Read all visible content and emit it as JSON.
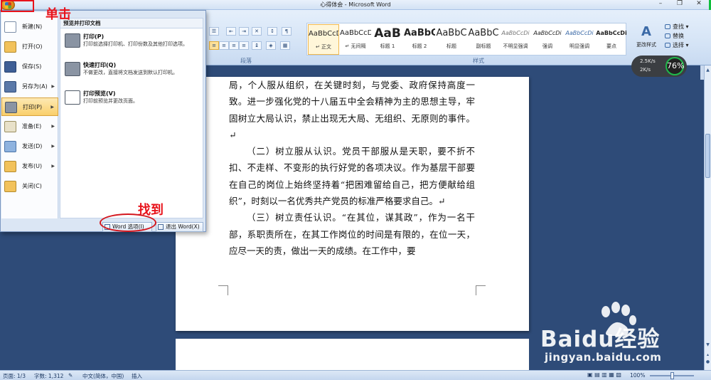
{
  "window": {
    "title": "心得体会 - Microsoft Word",
    "controls": [
      "–",
      "❐",
      "✕"
    ]
  },
  "ribbon": {
    "group_paragraph": "段落",
    "group_styles": "样式",
    "styles": [
      {
        "sample": "AaBbCcD",
        "name": "↵ 正文"
      },
      {
        "sample": "AaBbCcD",
        "name": "↵ 无间隔"
      },
      {
        "sample": "AaB",
        "name": "标题 1"
      },
      {
        "sample": "AaBbC",
        "name": "标题 2"
      },
      {
        "sample": "AaBbC",
        "name": "标题"
      },
      {
        "sample": "AaBbC",
        "name": "副标题"
      },
      {
        "sample": "AaBbCcDi",
        "name": "不明显强调"
      },
      {
        "sample": "AaBbCcDi",
        "name": "强调"
      },
      {
        "sample": "AaBbCcDi",
        "name": "明显强调"
      },
      {
        "sample": "AaBbCcDi",
        "name": "要点"
      }
    ],
    "change_styles": "更改样式",
    "editing": {
      "find": "查找",
      "replace": "替换",
      "select": "选择"
    }
  },
  "net_widget": {
    "up": "2.5K/s",
    "down": "2K/s",
    "percent": "76%"
  },
  "office_menu": {
    "items": [
      {
        "label": "新建(N)",
        "has_arrow": false
      },
      {
        "label": "打开(O)",
        "has_arrow": false
      },
      {
        "label": "保存(S)",
        "has_arrow": false
      },
      {
        "label": "另存为(A)",
        "has_arrow": true
      },
      {
        "label": "打印(P)",
        "has_arrow": true,
        "selected": true
      },
      {
        "label": "准备(E)",
        "has_arrow": true
      },
      {
        "label": "发送(D)",
        "has_arrow": true
      },
      {
        "label": "发布(U)",
        "has_arrow": true
      },
      {
        "label": "关闭(C)",
        "has_arrow": false
      }
    ],
    "submenu": {
      "header": "预览并打印文档",
      "items": [
        {
          "title": "打印(P)",
          "desc": "打印前选择打印机、打印份数及其他打印选项。"
        },
        {
          "title": "快速打印(Q)",
          "desc": "不做更改，直接将文档发送到默认打印机。"
        },
        {
          "title": "打印预览(V)",
          "desc": "打印前预览并更改页面。"
        }
      ]
    },
    "footer": {
      "options": "Word 选项(I)",
      "exit": "退出 Word(X)"
    }
  },
  "annotations": {
    "click": "单击",
    "find": "找到"
  },
  "document": {
    "paragraphs": [
      "局，个人服从组织，在关键时刻，与党委、政府保持高度一致。进一步强化党的十八届五中全会精神为主的思想主导，牢固树立大局认识，禁止出现无大局、无组织、无原则的事件。↵",
      "（二）树立服从认识。党员干部服从是天职，要不折不扣、不走样、不变形的执行好党的各项决议。作为基层干部要在自己的岗位上始终坚持着“把困难留给自己，把方便献给组织”，时刻以一名优秀共产党员的标准严格要求自己。↵",
      "（三）树立责任认识。“在其位，谋其政”，作为一名干部，系职责所在，在其工作岗位的时间是有限的，在位一天，应尽一天的责，做出一天的成绩。在工作中，要"
    ]
  },
  "status_bar": {
    "page": "页面: 1/3",
    "words": "字数: 1,312",
    "language": "中文(简体，中国)",
    "mode": "插入",
    "zoom": "100%"
  },
  "watermark": {
    "brand": "Baidu经验",
    "url": "jingyan.baidu.com"
  }
}
